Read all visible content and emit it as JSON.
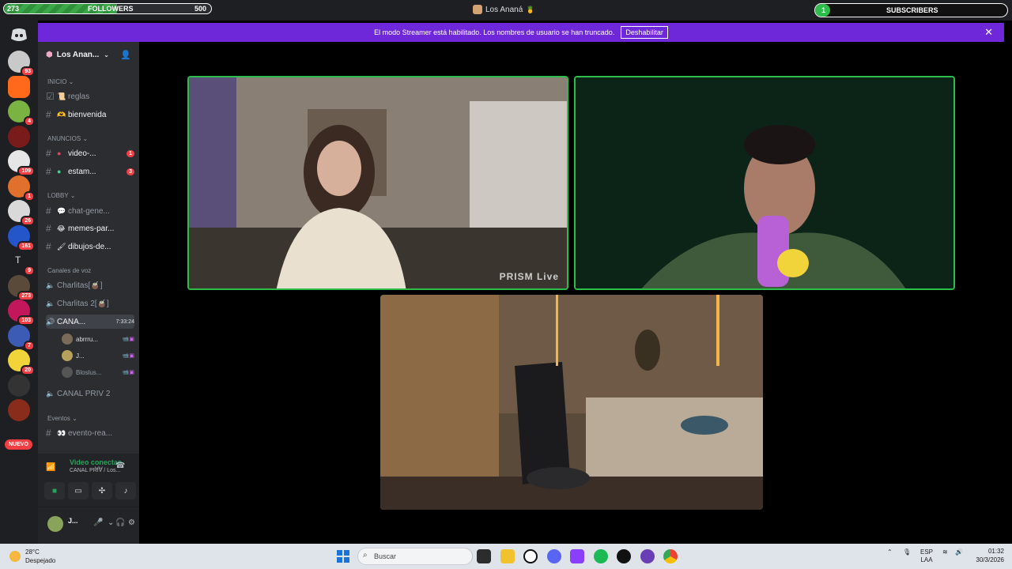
{
  "overlay": {
    "followers": {
      "current": "273",
      "label": "FOLLOWERS",
      "goal": "500",
      "progress_fraction": 0.546
    },
    "subscribers": {
      "current": "1",
      "label": "SUBSCRIBERS",
      "progress_fraction": 0.08
    }
  },
  "window": {
    "title": "Los Ananá"
  },
  "banner": {
    "message": "El modo Streamer está habilitado. Los nombres de usuario se han truncado.",
    "button": "Deshabilitar"
  },
  "servers": [
    {
      "badge": "93"
    },
    {
      "badge": ""
    },
    {
      "badge": "4"
    },
    {
      "badge": ""
    },
    {
      "badge": "109"
    },
    {
      "badge": "1"
    },
    {
      "badge": "26"
    },
    {
      "badge": "161"
    },
    {
      "badge": "9",
      "letter": "T"
    },
    {
      "badge": "273"
    },
    {
      "badge": "103"
    },
    {
      "badge": "7"
    },
    {
      "badge": "20"
    },
    {
      "badge": ""
    },
    {
      "badge": ""
    }
  ],
  "new_label": "NUEVO",
  "sidebar": {
    "server_name": "Los Anan...",
    "categories": {
      "inicio": "INICIO",
      "anuncios": "ANUNCIOS",
      "lobby": "LOBBY",
      "voz": "Canales de voz",
      "eventos": "Eventos"
    },
    "channels": {
      "reglas": "reglas",
      "bienvenida": "bienvenida",
      "video": "video-...",
      "video_badge": "1",
      "estam": "estam...",
      "estam_badge": "3",
      "chat": "chat-gene...",
      "memes": "memes-par...",
      "dibujos": "dibujos-de...",
      "charlitas": "Charlitas[🧉]",
      "charlitas2": "Charlitas 2[🧉]",
      "canal": "CANA...",
      "canal_timer": "7:33:24",
      "canal_priv2": "CANAL PRIV 2",
      "evento": "evento-rea..."
    },
    "members": [
      "abrrru...",
      "J...",
      "Bloslus..."
    ],
    "voice": {
      "status": "Video conectac",
      "channel": "CANAL PRIV / Los..."
    },
    "user": {
      "name": "J..."
    }
  },
  "stage": {
    "watermark": "PRISM Live"
  },
  "taskbar": {
    "temp": "28°C",
    "weather": "Despejado",
    "search_placeholder": "Buscar",
    "lang": "ESP",
    "lang2": "LAA",
    "time": "01:32",
    "date": "30/3/2026"
  }
}
